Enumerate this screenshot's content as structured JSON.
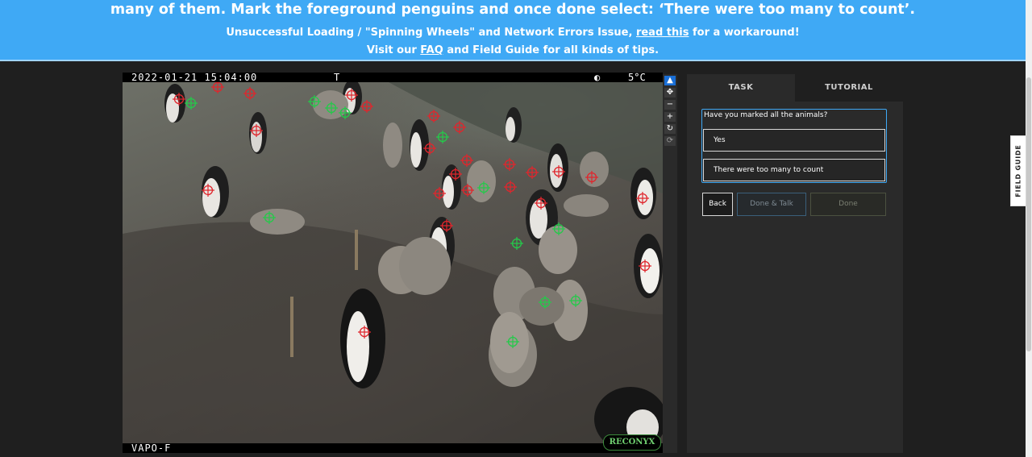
{
  "banner": {
    "headline": "many of them. Mark the foreground penguins and once done select: ‘There were too many to count’.",
    "line2_prefix": "Unsuccessful Loading / \"Spinning Wheels\" and Network Errors Issue, ",
    "line2_link": "read this",
    "line2_suffix": " for a workaround!",
    "line3_prefix": "Visit our ",
    "line3_link": "FAQ",
    "line3_suffix": " and Field Guide for all kinds of tips."
  },
  "camera": {
    "timestamp": "2022-01-21 15:04:00",
    "trigger_mark": "T",
    "moon_icon": "moon-phase-icon",
    "temperature": "5°C",
    "camera_id": "VAPO-F",
    "brand": "RECONYX"
  },
  "tools": [
    {
      "name": "pointer-tool",
      "glyph": "▲",
      "icon": "cursor-icon"
    },
    {
      "name": "pan-tool",
      "glyph": "✥",
      "icon": "move-icon"
    },
    {
      "name": "zoom-out-tool",
      "glyph": "−",
      "icon": "minus-icon"
    },
    {
      "name": "zoom-in-tool",
      "glyph": "+",
      "icon": "plus-icon"
    },
    {
      "name": "rotate-tool",
      "glyph": "↻",
      "icon": "rotate-icon"
    },
    {
      "name": "reset-tool",
      "glyph": "⟳",
      "icon": "reset-icon"
    }
  ],
  "panel": {
    "tabs": [
      {
        "label": "TASK"
      },
      {
        "label": "TUTORIAL"
      }
    ],
    "question": "Have you marked all the animals?",
    "answers": [
      {
        "label": "Yes"
      },
      {
        "label": "There were too many to count"
      }
    ],
    "buttons": {
      "back": "Back",
      "done_talk": "Done & Talk",
      "done": "Done"
    }
  },
  "field_guide": {
    "label": "FIELD GUIDE"
  },
  "colors": {
    "banner": "#3fa9f5",
    "adult_marker": "#e0262d",
    "chick_marker": "#25c94a",
    "active_tool": "#1a6fd6"
  }
}
